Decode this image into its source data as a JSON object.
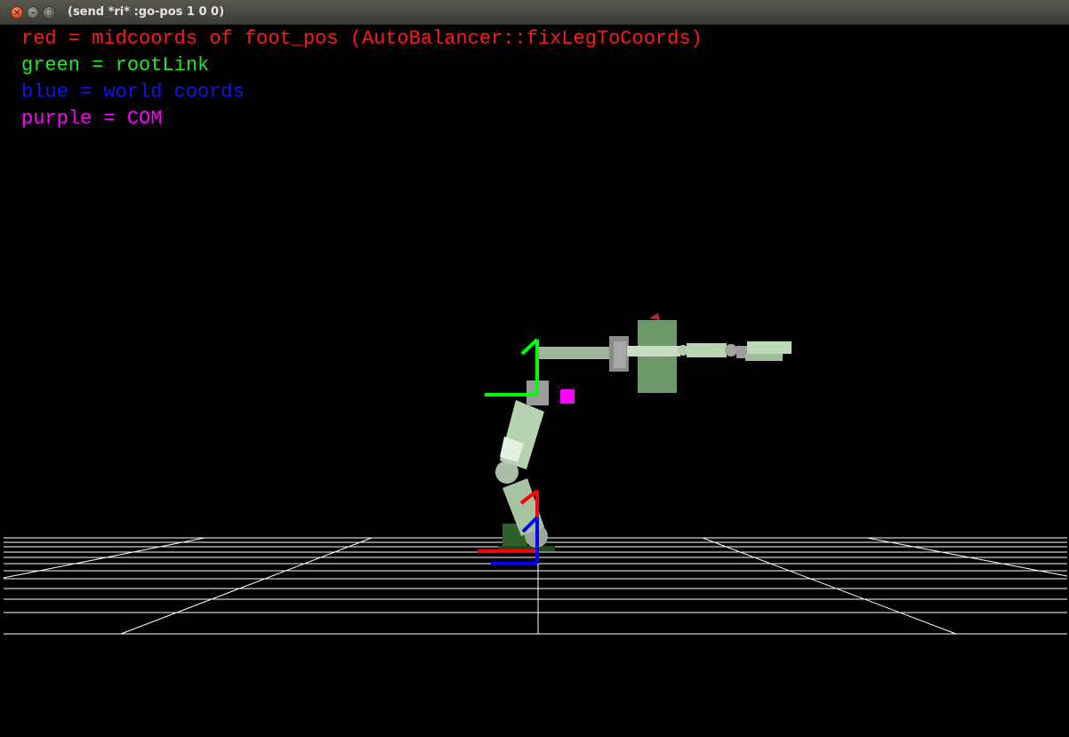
{
  "window": {
    "title": "(send *ri* :go-pos 1 0 0)",
    "buttons": {
      "close_glyph": "×",
      "minimize_glyph": "–",
      "maximize_glyph": "□"
    }
  },
  "legend": [
    {
      "text": "red = midcoords of foot_pos (AutoBalancer::fixLegToCoords)",
      "color": "#ff1a1a"
    },
    {
      "text": "green = rootLink",
      "color": "#22e822"
    },
    {
      "text": "blue = world coords",
      "color": "#1414e6"
    },
    {
      "text": "purple = COM",
      "color": "#ff00ff"
    }
  ],
  "scene": {
    "background_color": "#000000",
    "grid_color": "#ffffff",
    "robot_color": "#a9c9a4",
    "axis_colors": {
      "midcoords": "#ff0000",
      "root_link": "#00ff00",
      "world": "#0000ff",
      "com": "#ff00ff"
    }
  }
}
